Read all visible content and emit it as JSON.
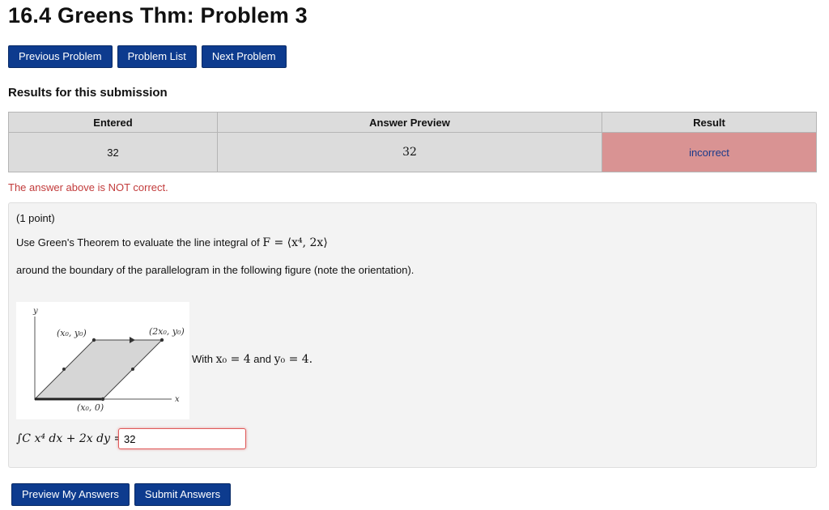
{
  "page_title": "16.4 Greens Thm: Problem 3",
  "nav": {
    "previous": "Previous Problem",
    "list": "Problem List",
    "next": "Next Problem"
  },
  "results": {
    "heading": "Results for this submission",
    "columns": [
      "Entered",
      "Answer Preview",
      "Result"
    ],
    "row": {
      "entered": "32",
      "preview": "32",
      "result": "incorrect"
    },
    "notice": "The answer above is NOT correct."
  },
  "problem": {
    "points": "(1 point)",
    "statement_prefix": "Use Green's Theorem to evaluate the line integral of ",
    "field_expr": "F = ⟨x⁴, 2x⟩",
    "statement_2": "around the boundary of the parallelogram in the following figure (note the orientation).",
    "figure_labels": {
      "y_axis": "y",
      "x_axis": "x",
      "top_left": "(x₀, y₀)",
      "top_right": "(2x₀, y₀)",
      "bottom": "(x₀, 0)"
    },
    "given_prefix": "With",
    "given_x": "x₀ = 4",
    "given_and": "and",
    "given_y": "y₀ = 4.",
    "integral_expr": "∫C x⁴ dx + 2x dy =",
    "answer_value": "32"
  },
  "actions": {
    "preview": "Preview My Answers",
    "submit": "Submit Answers"
  },
  "colors": {
    "button": "#0d3b8e",
    "incorrect_bg": "#d99393",
    "notice": "#c23b3b"
  }
}
